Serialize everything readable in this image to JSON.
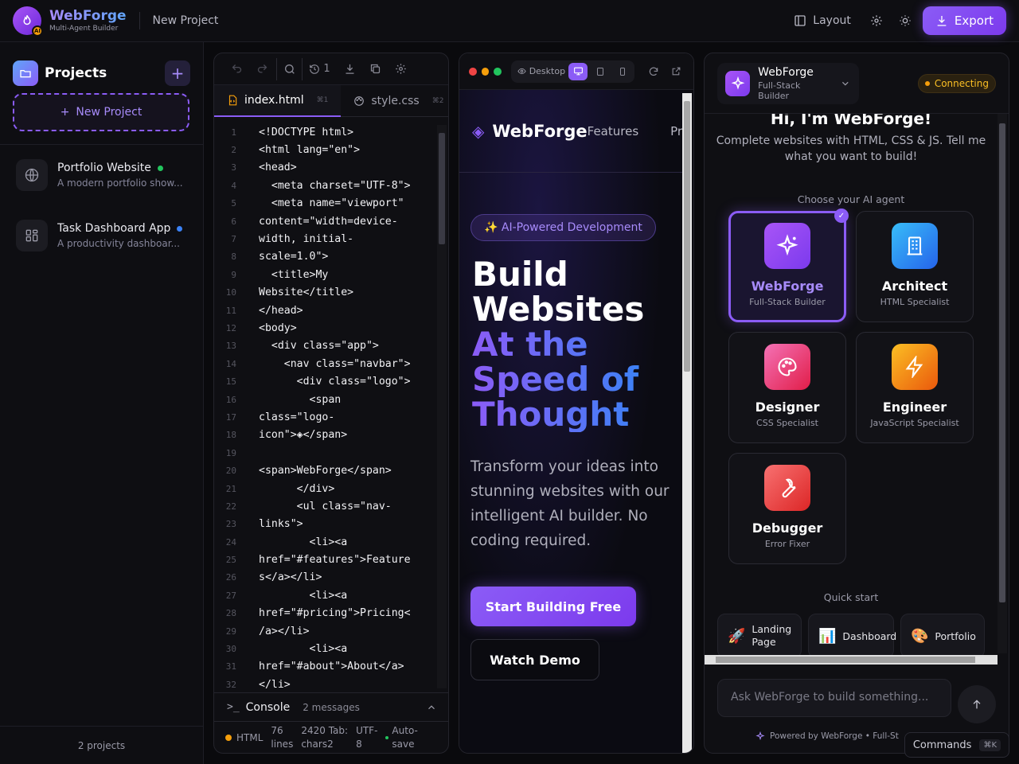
{
  "header": {
    "brand_name": "WebForge",
    "brand_sub": "Multi-Agent Builder",
    "badge": "AI",
    "project_name": "New Project",
    "layout_label": "Layout",
    "export_label": "Export"
  },
  "sidebar": {
    "title": "Projects",
    "new_project_label": "New Project",
    "projects": [
      {
        "name": "Portfolio Website",
        "desc": "A modern portfolio show...",
        "status_color": "#22c55e"
      },
      {
        "name": "Task Dashboard App",
        "desc": "A productivity dashboar...",
        "status_color": "#3b82f6"
      }
    ],
    "footer": "2 projects"
  },
  "editor": {
    "history_count": "1",
    "tabs": [
      {
        "label": "index.html",
        "shortcut": "⌘1"
      },
      {
        "label": "style.css",
        "shortcut": "⌘2"
      }
    ],
    "lines": [
      "<!DOCTYPE html>",
      "<html lang=\"en\">",
      "<head>",
      "  <meta charset=\"UTF-8\">",
      "  <meta name=\"viewport\"",
      "content=\"width=device-",
      "width, initial-",
      "scale=1.0\">",
      "  <title>My",
      "Website</title>",
      "</head>",
      "<body>",
      "  <div class=\"app\">",
      "    <nav class=\"navbar\">",
      "      <div class=\"logo\">",
      "        <span",
      "class=\"logo-",
      "icon\">◈</span>",
      "",
      "<span>WebForge</span>",
      "      </div>",
      "      <ul class=\"nav-",
      "links\">",
      "        <li><a",
      "href=\"#features\">Feature",
      "s</a></li>",
      "        <li><a",
      "href=\"#pricing\">Pricing<",
      "/a></li>",
      "        <li><a",
      "href=\"#about\">About</a>",
      "</li>"
    ],
    "console_label": "Console",
    "console_count": "2 messages",
    "status": {
      "lang": "HTML",
      "lines": "76",
      "lines_unit": "lines",
      "chars": "2420",
      "chars_unit": "chars",
      "tab_label": "Tab:",
      "tab_size": "2",
      "encoding": "UTF-",
      "encoding2": "8",
      "autosave": "Auto-",
      "autosave2": "save"
    }
  },
  "preview": {
    "device_label": "Desktop",
    "nav_logo": "◈",
    "nav_brand": "WebForge",
    "nav_links": [
      "Features",
      "Pri"
    ],
    "badge": "✨ AI-Powered Development",
    "hero_lines_white": [
      "Build",
      "Websites"
    ],
    "hero_lines_grad": [
      "At the",
      "Speed of",
      "Thought"
    ],
    "subtitle": "Transform your ideas into stunning websites with our intelligent AI builder. No coding required.",
    "cta_primary": "Start Building Free",
    "cta_secondary": "Watch Demo"
  },
  "chat": {
    "agent_name": "WebForge",
    "agent_role": "Full-Stack Builder",
    "connection": "Connecting",
    "greeting": "Hi, I'm WebForge!",
    "greeting_sub": "Complete websites with HTML, CSS & JS. Tell me what you want to build!",
    "choose_label": "Choose your AI agent",
    "agents": [
      {
        "name": "WebForge",
        "role": "Full-Stack Builder",
        "icon": "sparkles-icon",
        "color": "#8b5cf6"
      },
      {
        "name": "Architect",
        "role": "HTML Specialist",
        "icon": "building-icon",
        "color": "#3b82f6"
      },
      {
        "name": "Designer",
        "role": "CSS Specialist",
        "icon": "palette-icon",
        "color": "#ec4899"
      },
      {
        "name": "Engineer",
        "role": "JavaScript Specialist",
        "icon": "zap-icon",
        "color": "#f59e0b"
      },
      {
        "name": "Debugger",
        "role": "Error Fixer",
        "icon": "wrench-icon",
        "color": "#ef4444"
      }
    ],
    "quick_start_label": "Quick start",
    "quick_start": [
      {
        "emoji": "🚀",
        "label1": "Landing",
        "label2": "Page"
      },
      {
        "emoji": "📊",
        "label1": "Dashboard",
        "label2": ""
      },
      {
        "emoji": "🎨",
        "label1": "Portfolio",
        "label2": ""
      }
    ],
    "input_placeholder": "Ask WebForge to build something...",
    "powered": "Powered by WebForge • Full-St",
    "commands_label": "Commands",
    "commands_kbd": "⌘K"
  }
}
